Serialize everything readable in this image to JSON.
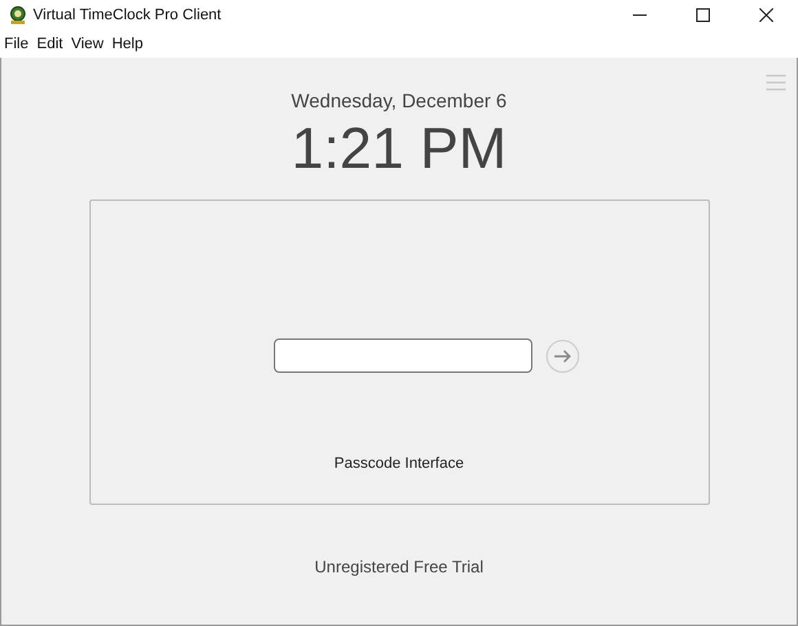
{
  "window": {
    "title": "Virtual TimeClock Pro Client"
  },
  "menu": [
    "File",
    "Edit",
    "View",
    "Help"
  ],
  "date": "Wednesday, December 6",
  "time": "1:21 PM",
  "panel": {
    "label": "Passcode Interface"
  },
  "footer": "Unregistered Free Trial"
}
